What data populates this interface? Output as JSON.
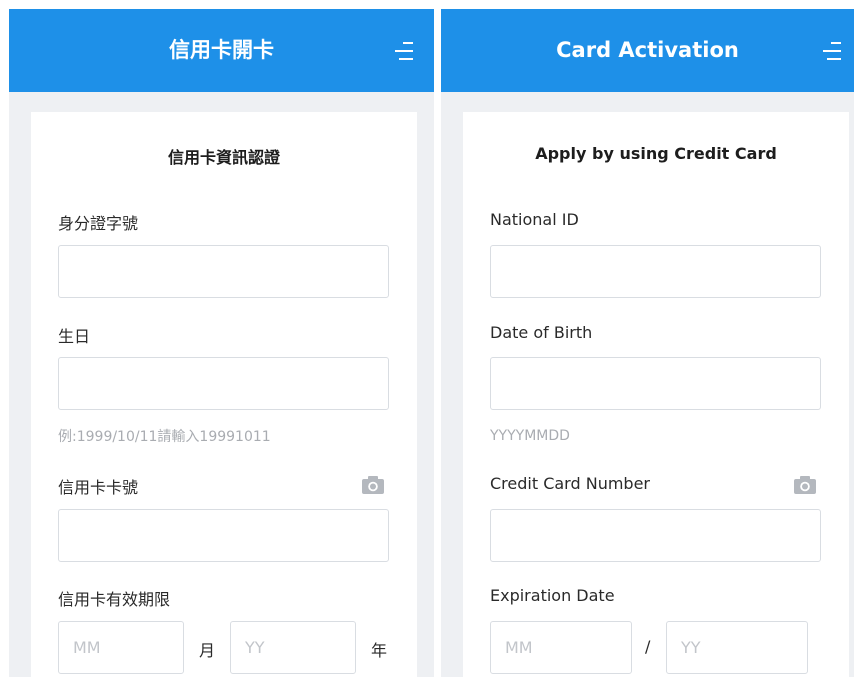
{
  "zh": {
    "app_title": "信用卡開卡",
    "card_title": "信用卡資訊認證",
    "national_id_label": "身分證字號",
    "national_id_value": "",
    "birth_label": "生日",
    "birth_value": "",
    "birth_hint": "例:1999/10/11請輸入19991011",
    "card_number_label": "信用卡卡號",
    "card_number_value": "",
    "expiry_label": "信用卡有效期限",
    "expiry_month_placeholder": "MM",
    "expiry_month_unit": "月",
    "expiry_year_placeholder": "YY",
    "expiry_year_unit": "年"
  },
  "en": {
    "app_title": "Card Activation",
    "card_title": "Apply by using Credit Card",
    "national_id_label": "National ID",
    "national_id_value": "",
    "birth_label": "Date of Birth",
    "birth_value": "",
    "birth_hint": "YYYYMMDD",
    "card_number_label": "Credit Card Number",
    "card_number_value": "",
    "expiry_label": "Expiration Date",
    "expiry_month_placeholder": "MM",
    "expiry_separator": "/",
    "expiry_year_placeholder": "YY"
  },
  "icons": {
    "menu": "menu-icon",
    "camera": "camera-icon"
  },
  "colors": {
    "app_bar": "#1e90e8",
    "background": "#eef0f3",
    "field_border": "#d9dde2",
    "hint_text": "#a9acb1"
  }
}
